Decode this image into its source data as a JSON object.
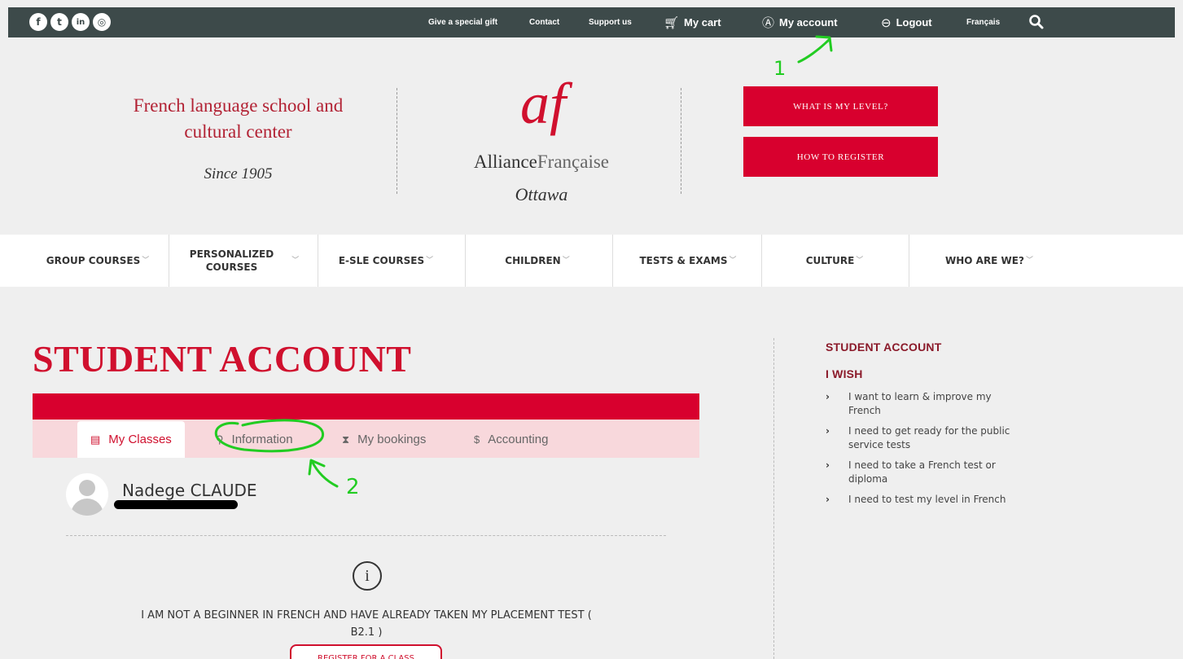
{
  "topbar": {
    "social": [
      {
        "icon": "facebook-icon",
        "glyph": "f"
      },
      {
        "icon": "twitter-icon",
        "glyph": "t"
      },
      {
        "icon": "linkedin-icon",
        "glyph": "in"
      },
      {
        "icon": "instagram-icon",
        "glyph": "◎"
      }
    ],
    "links": {
      "gift": "Give a special gift",
      "contact": "Contact",
      "support": "Support us",
      "cart": "My cart",
      "account": "My account",
      "logout": "Logout",
      "language": "Français"
    }
  },
  "header": {
    "tagline_line1": "French language school and",
    "tagline_line2": "cultural center",
    "since": "Since 1905",
    "logo_mark": "af",
    "logo_name_bold": "Alliance",
    "logo_name_light": "Française",
    "logo_city": "Ottawa",
    "level_button": "WHAT IS MY LEVEL?",
    "register_button": "HOW TO REGISTER"
  },
  "nav": {
    "group": "GROUP COURSES",
    "personalized_1": "PERSONALIZED",
    "personalized_2": "COURSES",
    "esle": "E-SLE COURSES",
    "children": "CHILDREN",
    "tests": "TESTS & EXAMS",
    "culture": "CULTURE",
    "who": "WHO ARE WE?"
  },
  "main": {
    "title": "STUDENT ACCOUNT",
    "tabs": {
      "classes": "My Classes",
      "information": "Information",
      "bookings": "My bookings",
      "accounting": "Accounting"
    },
    "user_name": "Nadege CLAUDE",
    "notice_line1": "I AM NOT A BEGINNER IN FRENCH AND HAVE ALREADY TAKEN MY PLACEMENT TEST (",
    "notice_line2": "B2.1 )",
    "register_class": "REGISTER FOR A CLASS"
  },
  "sidebar": {
    "heading": "STUDENT ACCOUNT",
    "subheading": "I WISH",
    "items": [
      "I want to learn & improve my French",
      "I need to get ready for the public service tests",
      "I need to take a French test or diploma",
      "I need to test my level in French"
    ]
  },
  "annotations": {
    "one": "1",
    "two": "2"
  },
  "colors": {
    "topbar": "#3d4a4a",
    "brand_red": "#d8002e",
    "tab_bar": "#f8d8dc",
    "annotation_green": "#22cc22"
  }
}
